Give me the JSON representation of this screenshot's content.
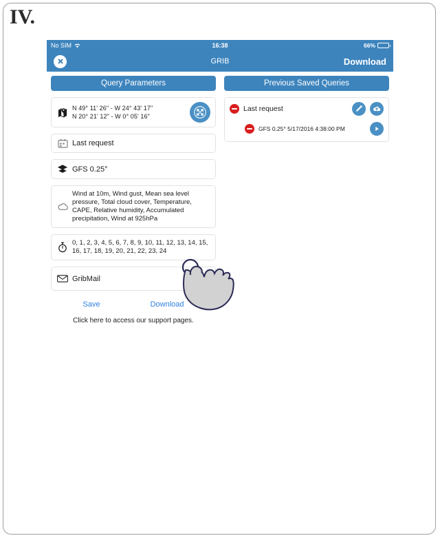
{
  "figure": {
    "label": "IV."
  },
  "statusbar": {
    "carrier": "No SIM",
    "wifi_icon": "wifi-icon",
    "time": "16:38",
    "battery_percent": "66%",
    "battery_icon": "battery-icon"
  },
  "navbar": {
    "close_icon": "close-circle-icon",
    "title": "GRIB",
    "action_label": "Download"
  },
  "tabs": {
    "query_parameters": "Query Parameters",
    "previous_saved_queries": "Previous Saved Queries"
  },
  "query_form": {
    "coordinates": {
      "icon": "map-pin-icon",
      "line1": "N 49° 11' 26\" - W 24° 43' 17\"",
      "line2": "N 20° 21' 12\" - W 0° 05' 16\"",
      "expand_button_icon": "expand-arrows-icon"
    },
    "request_name": {
      "icon": "calendar-icon",
      "value": "Last request"
    },
    "model": {
      "icon": "layers-icon",
      "value": "GFS 0.25°"
    },
    "parameters": {
      "icon": "cloud-icon",
      "value": "Wind at 10m, Wind gust, Mean sea level pressure, Total cloud cover, Temperature, CAPE, Relative humidity, Accumulated precipitation, Wind at 925hPa"
    },
    "time_steps": {
      "icon": "stopwatch-icon",
      "value": "0, 1, 2, 3, 4, 5, 6, 7, 8, 9, 10, 11, 12, 13, 14, 15, 16, 17, 18, 19, 20, 21, 22, 23, 24"
    },
    "gribmail": {
      "icon": "envelope-icon",
      "label": "GribMail",
      "toggle_state": "off"
    },
    "save_label": "Save",
    "download_label": "Download",
    "support_text": "Click here to access our support pages."
  },
  "saved_queries": [
    {
      "delete_icon": "minus-circle-icon",
      "title": "Last request",
      "edit_icon": "pencil-icon",
      "upload_icon": "cloud-upload-icon",
      "child": {
        "delete_icon": "minus-circle-icon",
        "title": "GFS 0.25° 5/17/2016 4:38:00 PM",
        "run_icon": "play-icon"
      }
    }
  ],
  "cursor": {
    "icon": "hand-tap-icon"
  },
  "colors": {
    "accent_blue": "#3d84bd",
    "button_blue": "#4a90c4",
    "link_blue": "#2f7fe0",
    "delete_red": "#d81e1e",
    "card_border": "#e2e2e2"
  }
}
